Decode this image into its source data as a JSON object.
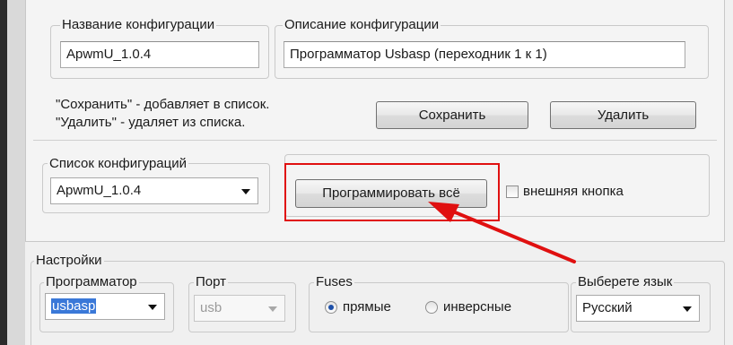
{
  "config": {
    "name_legend": "Название конфигурации",
    "name_value": "ApwmU_1.0.4",
    "description_legend": "Описание конфигурации",
    "description_value": "Программатор Usbasp  (переходник 1 к 1)",
    "help_line1": "\"Сохранить\" - добавляет в список.",
    "help_line2": "\"Удалить\" - удаляет из списка.",
    "save_label": "Сохранить",
    "delete_label": "Удалить",
    "list_legend": "Список конфигураций",
    "list_value": "ApwmU_1.0.4",
    "program_all_label": "Программировать всё",
    "external_button_label": "внешняя кнопка"
  },
  "settings": {
    "legend": "Настройки",
    "programmer_legend": "Программатор",
    "programmer_value": "usbasp",
    "port_legend": "Порт",
    "port_value": "usb",
    "fuses_legend": "Fuses",
    "fuses_option_direct": "прямые",
    "fuses_option_inverse": "инверсные",
    "fuses_selected": "прямые",
    "language_legend": "Выберете язык",
    "language_value": "Русский"
  },
  "annotation": {
    "highlight_color": "#e01010",
    "arrow_color": "#e01010"
  }
}
